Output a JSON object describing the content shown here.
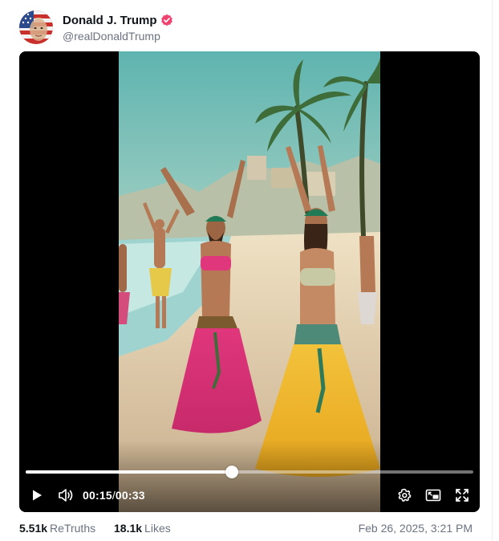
{
  "post": {
    "author": {
      "display_name": "Donald J. Trump",
      "handle": "@realDonaldTrump",
      "verified": true,
      "verified_color": "#f0426f"
    },
    "video": {
      "current_time": "00:15",
      "separator": "/",
      "duration": "00:33",
      "progress_fraction": 0.46,
      "controls": [
        "play-icon",
        "volume-icon",
        "settings-icon",
        "picture-in-picture-icon",
        "fullscreen-icon"
      ]
    },
    "stats": {
      "retruths_count": "5.51k",
      "retruths_label": "ReTruths",
      "likes_count": "18.1k",
      "likes_label": "Likes"
    },
    "timestamp": "Feb 26, 2025, 3:21 PM"
  }
}
